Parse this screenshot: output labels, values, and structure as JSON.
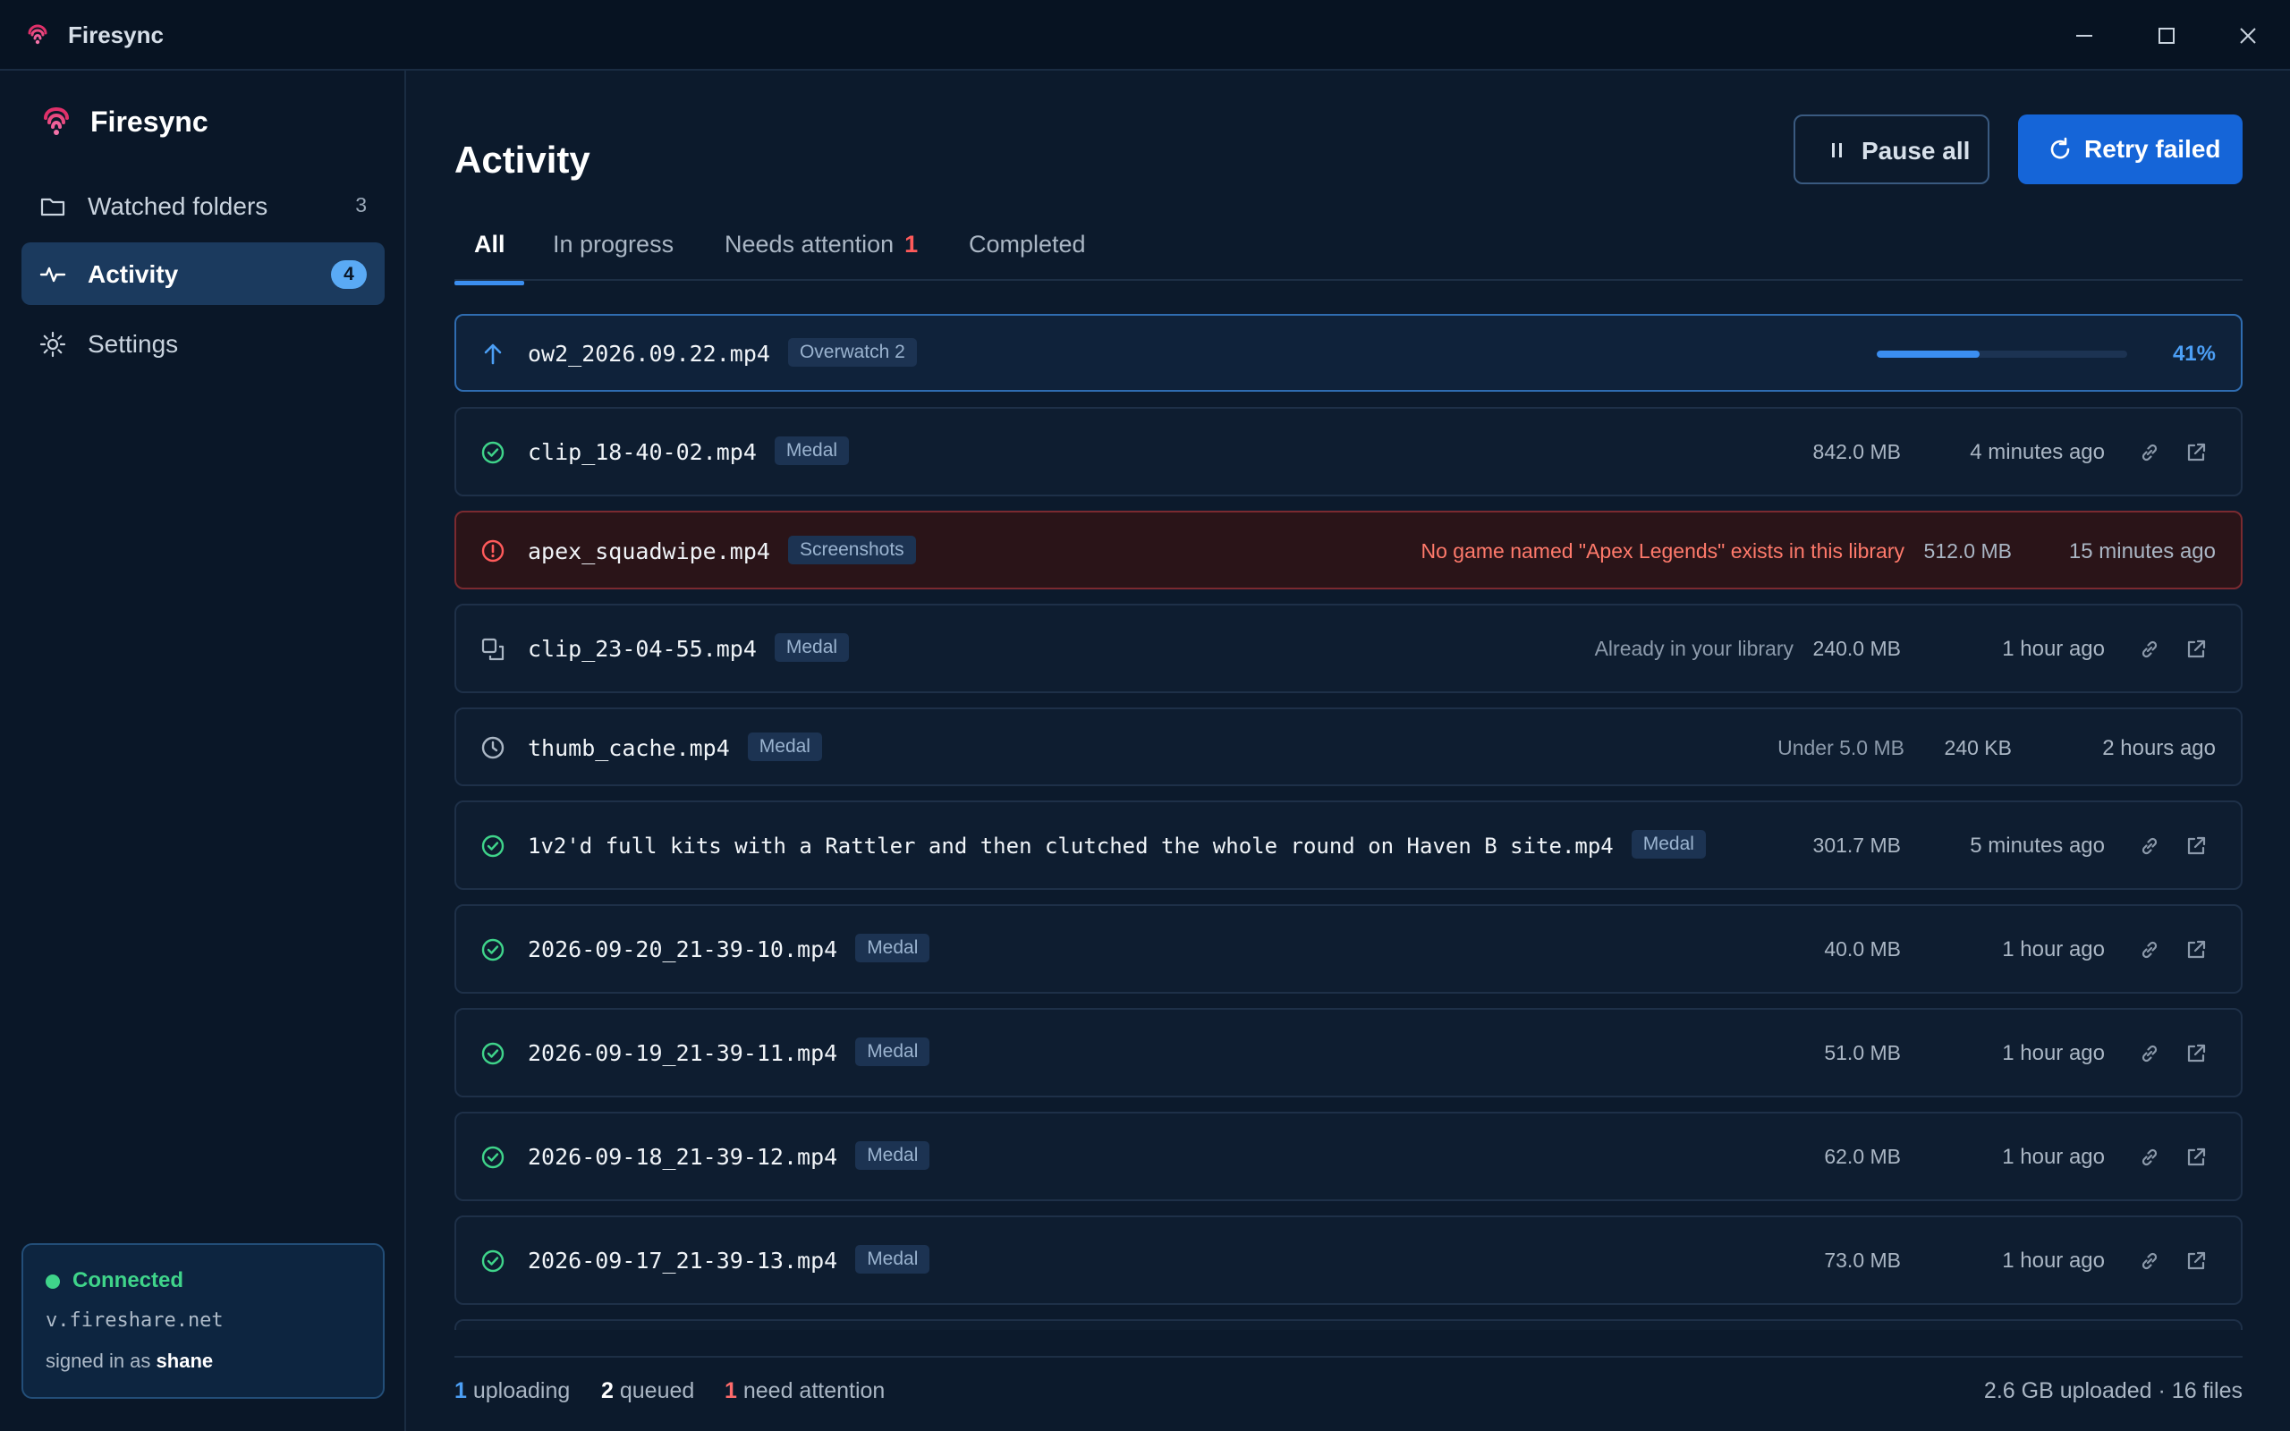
{
  "window": {
    "title": "Firesync"
  },
  "sidebar": {
    "brand": "Firesync",
    "items": [
      {
        "label": "Watched folders",
        "count": "3"
      },
      {
        "label": "Activity",
        "count": "4"
      },
      {
        "label": "Settings",
        "count": ""
      }
    ],
    "connection": {
      "status": "Connected",
      "host": "v.fireshare.net",
      "signed_in_prefix": "signed in as",
      "user": "shane"
    }
  },
  "main": {
    "title": "Activity",
    "pause_label": "Pause all",
    "retry_label": "Retry failed",
    "tabs": [
      {
        "label": "All"
      },
      {
        "label": "In progress"
      },
      {
        "label": "Needs attention",
        "count": "1"
      },
      {
        "label": "Completed"
      }
    ]
  },
  "rows": [
    {
      "status": "uploading",
      "name": "ow2_2026.09.22.mp4",
      "tag": "Overwatch 2",
      "progress": 0.41,
      "percent": "41%"
    },
    {
      "status": "done",
      "name": "clip_18-40-02.mp4",
      "tag": "Medal",
      "size": "842.0 MB",
      "time": "4 minutes ago"
    },
    {
      "status": "error",
      "name": "apex_squadwipe.mp4",
      "tag": "Screenshots",
      "note": "No game named \"Apex Legends\" exists in this library",
      "size": "512.0 MB",
      "time": "15 minutes ago"
    },
    {
      "status": "duplicate",
      "name": "clip_23-04-55.mp4",
      "tag": "Medal",
      "note": "Already in your library",
      "size": "240.0 MB",
      "time": "1 hour ago"
    },
    {
      "status": "skipped",
      "name": "thumb_cache.mp4",
      "tag": "Medal",
      "note": "Under 5.0 MB",
      "size": "240 KB",
      "time": "2 hours ago"
    },
    {
      "status": "done",
      "name": "1v2'd full kits with a Rattler and then clutched the whole round on Haven B site.mp4",
      "tag": "Medal",
      "size": "301.7 MB",
      "time": "5 minutes ago"
    },
    {
      "status": "done",
      "name": "2026-09-20_21-39-10.mp4",
      "tag": "Medal",
      "size": "40.0 MB",
      "time": "1 hour ago"
    },
    {
      "status": "done",
      "name": "2026-09-19_21-39-11.mp4",
      "tag": "Medal",
      "size": "51.0 MB",
      "time": "1 hour ago"
    },
    {
      "status": "done",
      "name": "2026-09-18_21-39-12.mp4",
      "tag": "Medal",
      "size": "62.0 MB",
      "time": "1 hour ago"
    },
    {
      "status": "done",
      "name": "2026-09-17_21-39-13.mp4",
      "tag": "Medal",
      "size": "73.0 MB",
      "time": "1 hour ago"
    }
  ],
  "footer": {
    "uploading_count": "1",
    "uploading_label": "uploading",
    "queued_count": "2",
    "queued_label": "queued",
    "attention_count": "1",
    "attention_label": "need attention",
    "summary": "2.6 GB uploaded · 16 files"
  },
  "colors": {
    "accent": "#1565d8",
    "success": "#3fd48a",
    "error": "#ff5a5a",
    "background": "#0c1a2c"
  }
}
